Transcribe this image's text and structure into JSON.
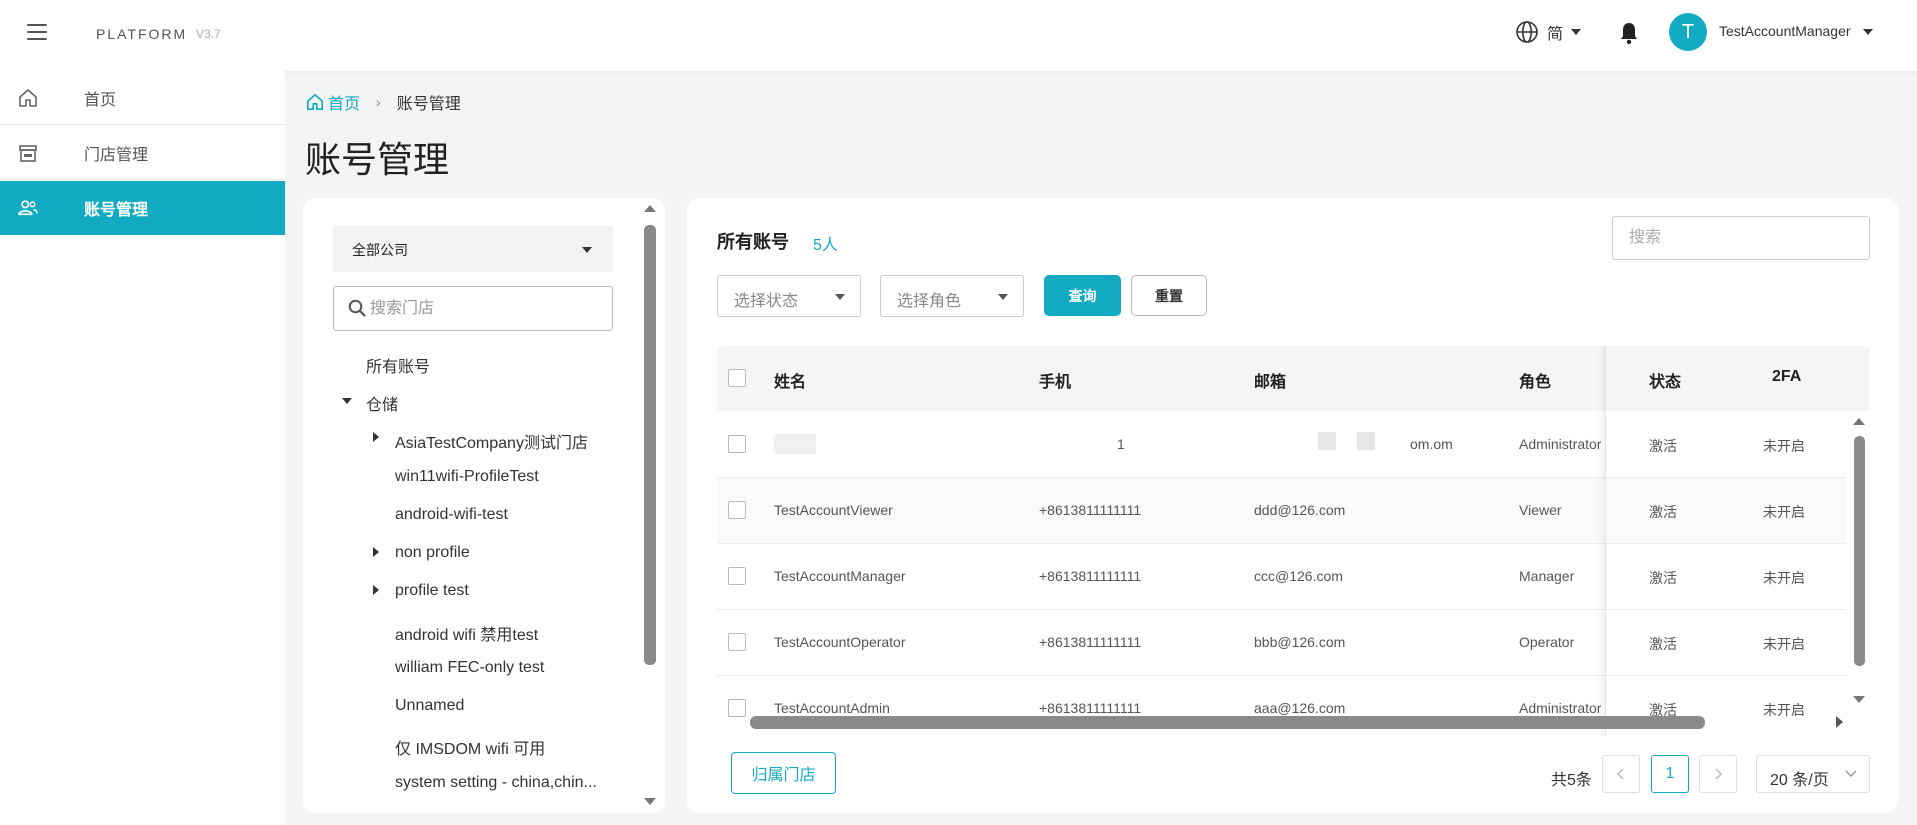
{
  "header": {
    "brand": "PLATFORM",
    "version": "V3.7",
    "language": "简",
    "username": "TestAccountManager",
    "avatar_letter": "T",
    "accent_color": "#12aac2"
  },
  "sidebar": {
    "items": [
      {
        "label": "首页",
        "icon": "home-icon",
        "active": false
      },
      {
        "label": "门店管理",
        "icon": "store-icon",
        "active": false
      },
      {
        "label": "账号管理",
        "icon": "users-icon",
        "active": true
      }
    ]
  },
  "breadcrumb": {
    "home": "首页",
    "current": "账号管理"
  },
  "page_title": "账号管理",
  "tree_panel": {
    "company_select": "全部公司",
    "store_search_placeholder": "搜索门店",
    "nodes": [
      {
        "label": "所有账号",
        "caret": "none",
        "indent": 0
      },
      {
        "label": "仓储",
        "caret": "down",
        "indent": 0
      },
      {
        "label": "AsiaTestCompany测试门店",
        "caret": "right",
        "indent": 1
      },
      {
        "label": "win11wifi-ProfileTest",
        "caret": "none",
        "indent": 1
      },
      {
        "label": "android-wifi-test",
        "caret": "none",
        "indent": 1
      },
      {
        "label": "non profile",
        "caret": "right",
        "indent": 1
      },
      {
        "label": "profile test",
        "caret": "right",
        "indent": 1
      },
      {
        "label": "android wifi 禁用test",
        "caret": "none",
        "indent": 1
      },
      {
        "label": "william FEC-only test",
        "caret": "none",
        "indent": 1
      },
      {
        "label": "Unnamed",
        "caret": "none",
        "indent": 1
      },
      {
        "label": "仅 IMSDOM wifi 可用",
        "caret": "none",
        "indent": 1
      },
      {
        "label": "system setting - china,chin...",
        "caret": "none",
        "indent": 1
      }
    ]
  },
  "main": {
    "section_title": "所有账号",
    "count": "5人",
    "search_placeholder": "搜索",
    "status_select_placeholder": "选择状态",
    "role_select_placeholder": "选择角色",
    "query_button": "查询",
    "reset_button": "重置",
    "columns": [
      "姓名",
      "手机",
      "邮箱",
      "角色",
      "状态",
      "2FA"
    ],
    "rows": [
      {
        "name": "",
        "phone": "1",
        "email": "om.om",
        "role": "Administrator",
        "status": "激活",
        "twofa": "未开启",
        "masked": true
      },
      {
        "name": "TestAccountViewer",
        "phone": "+8613811111111",
        "email": "ddd@126.com",
        "role": "Viewer",
        "status": "激活",
        "twofa": "未开启",
        "masked": false
      },
      {
        "name": "TestAccountManager",
        "phone": "+8613811111111",
        "email": "ccc@126.com",
        "role": "Manager",
        "status": "激活",
        "twofa": "未开启",
        "masked": false
      },
      {
        "name": "TestAccountOperator",
        "phone": "+8613811111111",
        "email": "bbb@126.com",
        "role": "Operator",
        "status": "激活",
        "twofa": "未开启",
        "masked": false
      },
      {
        "name": "TestAccountAdmin",
        "phone": "+8613811111111",
        "email": "aaa@126.com",
        "role": "Administrator",
        "status": "激活",
        "twofa": "未开启",
        "masked": false
      }
    ],
    "assign_store_button": "归属门店",
    "total_text": "共5条",
    "current_page": "1",
    "page_size": "20 条/页"
  }
}
